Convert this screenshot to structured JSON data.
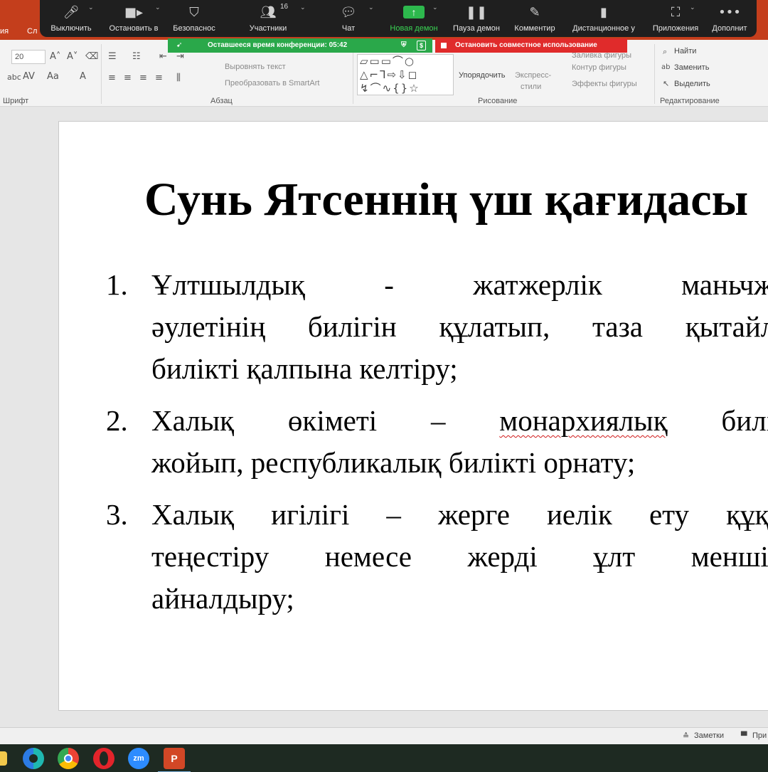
{
  "powerpoint": {
    "tabs": [
      "ия",
      "Сл"
    ],
    "ribbon": {
      "font_size": "20",
      "font_group_label": "Шрифт",
      "paragraph_group_label": "Абзац",
      "drawing_group_label": "Рисование",
      "editing_group_label": "Редактирование",
      "align_text": "Выровнять текст",
      "convert_smartart": "Преобразовать в SmartArt",
      "arrange": "Упорядочить",
      "quick_styles_1": "Экспресс-",
      "quick_styles_2": "стили",
      "shape_fill": "Заливка фигуры",
      "shape_outline": "Контур фигуры",
      "shape_effects": "Эффекты фигуры",
      "find": "Найти",
      "replace": "Заменить",
      "select": "Выделить"
    },
    "slide": {
      "title": "Сунь Ятсеннің үш қағидасы",
      "items": [
        {
          "number": "1.",
          "lines": [
            [
              "Ұлтшылдық",
              "-",
              "жатжерлік",
              "маньчжу"
            ],
            [
              "әулетінің",
              "билігін",
              "құлатып,",
              "таза",
              "қытайль"
            ],
            [
              "билікті қалпына келтіру;"
            ]
          ]
        },
        {
          "number": "2.",
          "lines": [
            [
              "Халық",
              "өкіметі",
              "–",
              "монархиялық",
              "билік"
            ],
            [
              "жойып, республикалық билікті орнату;"
            ]
          ]
        },
        {
          "number": "3.",
          "lines": [
            [
              "Халық",
              "игілігі",
              "–",
              "жерге",
              "иелік",
              "ету",
              "құқы"
            ],
            [
              "теңестіру",
              "немесе",
              "жерді",
              "ұлт",
              "меншігі"
            ],
            [
              "айналдыру;"
            ]
          ]
        }
      ]
    },
    "status_bar": {
      "notes": "Заметки",
      "comments": "При"
    }
  },
  "zoom": {
    "buttons": [
      {
        "id": "mute",
        "label": "Выключить",
        "icon": "microphone-icon"
      },
      {
        "id": "video",
        "label": "Остановить в",
        "icon": "video-camera-icon"
      },
      {
        "id": "security",
        "label": "Безопаснос",
        "icon": "shield-icon"
      },
      {
        "id": "participants",
        "label": "Участники",
        "icon": "participants-icon",
        "count": "16"
      },
      {
        "id": "chat",
        "label": "Чат",
        "icon": "chat-bubble-icon"
      },
      {
        "id": "share",
        "label": "Новая демон",
        "icon": "share-screen-icon"
      },
      {
        "id": "pause",
        "label": "Пауза демон",
        "icon": "pause-icon"
      },
      {
        "id": "annotate",
        "label": "Комментир",
        "icon": "pen-icon"
      },
      {
        "id": "remote",
        "label": "Дистанционное у",
        "icon": "mouse-icon"
      },
      {
        "id": "apps",
        "label": "Приложения",
        "icon": "apps-icon"
      },
      {
        "id": "more",
        "label": "Дополнит",
        "icon": "more-dots-icon"
      }
    ],
    "conference_time": "Оставшееся время конференции: 05:42",
    "stop_sharing": "Остановить совместное использование"
  },
  "taskbar": {
    "apps": [
      "file-explorer-icon",
      "edge-icon",
      "chrome-icon",
      "opera-icon",
      "zoom-icon",
      "powerpoint-icon"
    ],
    "zoom_label": "zm",
    "powerpoint_label": "P"
  }
}
